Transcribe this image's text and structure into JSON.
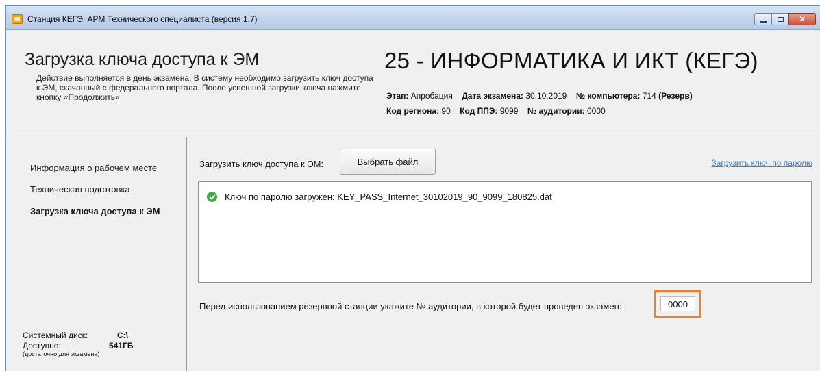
{
  "window": {
    "title": "Станция КЕГЭ. АРМ Технического специалиста (версия 1.7)"
  },
  "header": {
    "page_title": "Загрузка ключа доступа к ЭМ",
    "description": "Действие выполняется в день экзамена. В систему необходимо загрузить ключ доступа к ЭМ, скачанный с федерального портала. После успешной загрузки ключа нажмите кнопку «Продолжить»",
    "subject": "25 - ИНФОРМАТИКА И ИКТ (КЕГЭ)",
    "meta": {
      "stage_label": "Этап:",
      "stage_value": "Апробация",
      "date_label": "Дата экзамена:",
      "date_value": "30.10.2019",
      "computer_label": "№ компьютера:",
      "computer_value": "714",
      "reserve_label": "(Резерв)",
      "region_label": "Код региона:",
      "region_value": "90",
      "ppe_label": "Код ППЭ:",
      "ppe_value": "9099",
      "room_label": "№ аудитории:",
      "room_value": "0000"
    }
  },
  "sidebar": {
    "items": [
      {
        "label": "Информация о рабочем месте",
        "active": false
      },
      {
        "label": "Техническая подготовка",
        "active": false
      },
      {
        "label": "Загрузка ключа доступа к ЭМ",
        "active": true
      }
    ],
    "disk": {
      "system_label": "Системный диск:",
      "system_value": "C:\\",
      "free_label": "Доступно:",
      "free_value": "541ГБ",
      "note": "(достаточно для экзамена)"
    }
  },
  "main": {
    "upload_label": "Загрузить ключ доступа к ЭМ:",
    "choose_file_button": "Выбрать файл",
    "password_link": "Загрузить ключ по паролю",
    "log": [
      {
        "status": "success",
        "icon": "check-circle-icon",
        "text": "Ключ по паролю загружен: KEY_PASS_Internet_30102019_90_9099_180825.dat"
      }
    ],
    "room_prompt": "Перед использованием резервной станции укажите № аудитории, в которой будет проведен экзамен:",
    "room_input_value": "0000"
  },
  "colors": {
    "highlight_border": "#ef7d2b",
    "link": "#3b7fd6",
    "success": "#49a84b"
  }
}
